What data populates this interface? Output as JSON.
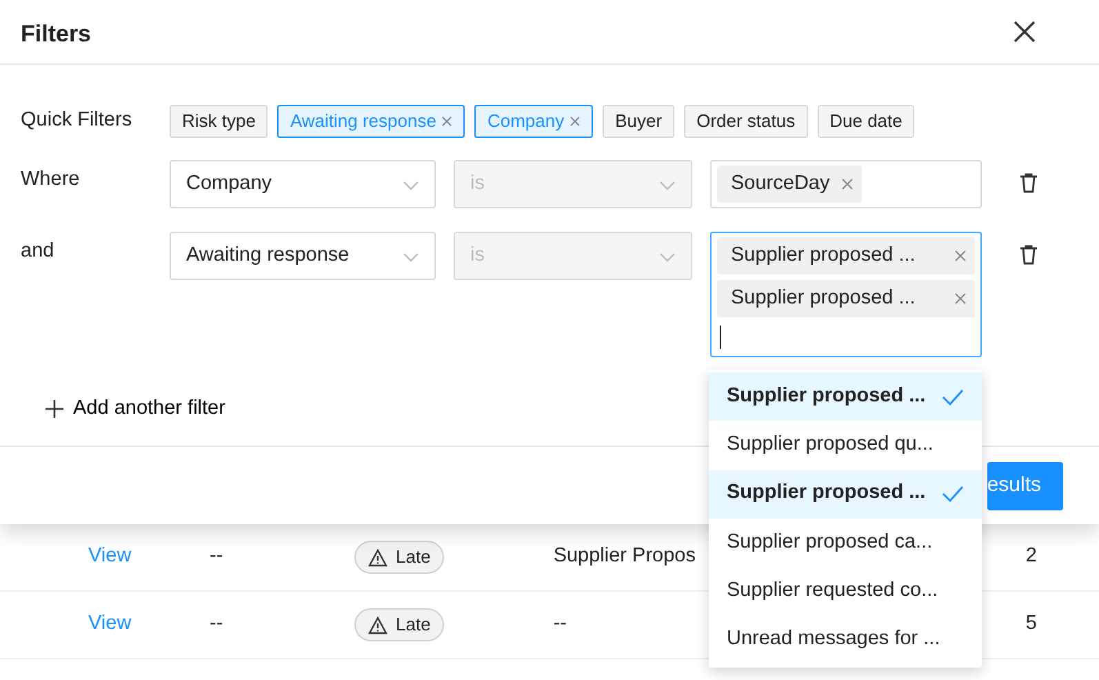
{
  "modal": {
    "title": "Filters",
    "quick_filters_label": "Quick Filters",
    "quick_filters": [
      {
        "label": "Risk type",
        "selected": false
      },
      {
        "label": "Awaiting response",
        "selected": true
      },
      {
        "label": "Company",
        "selected": true
      },
      {
        "label": "Buyer",
        "selected": false
      },
      {
        "label": "Order status",
        "selected": false
      },
      {
        "label": "Due date",
        "selected": false
      }
    ],
    "conditions": [
      {
        "connector": "Where",
        "field": "Company",
        "operator": "is",
        "operator_disabled": true,
        "values": [
          "SourceDay"
        ],
        "focused": false
      },
      {
        "connector": "and",
        "field": "Awaiting response",
        "operator": "is",
        "operator_disabled": true,
        "values": [
          "Supplier proposed ...",
          "Supplier proposed ..."
        ],
        "focused": true
      }
    ],
    "add_filter": "Add another filter",
    "apply_button": "esults"
  },
  "dropdown": [
    {
      "label": "Supplier proposed ...",
      "selected": true
    },
    {
      "label": "Supplier proposed qu...",
      "selected": false
    },
    {
      "label": "Supplier proposed ...",
      "selected": true
    },
    {
      "label": "Supplier proposed ca...",
      "selected": false
    },
    {
      "label": "Supplier requested co...",
      "selected": false
    },
    {
      "label": "Unread messages for ...",
      "selected": false
    }
  ],
  "table": {
    "rows": [
      {
        "link": "View",
        "column_2": "--",
        "status": "Late",
        "column_4": "Supplier Propos",
        "column_5": "2"
      },
      {
        "link": "View",
        "column_2": "--",
        "status": "Late",
        "column_4": "--",
        "column_5": "5"
      }
    ]
  }
}
